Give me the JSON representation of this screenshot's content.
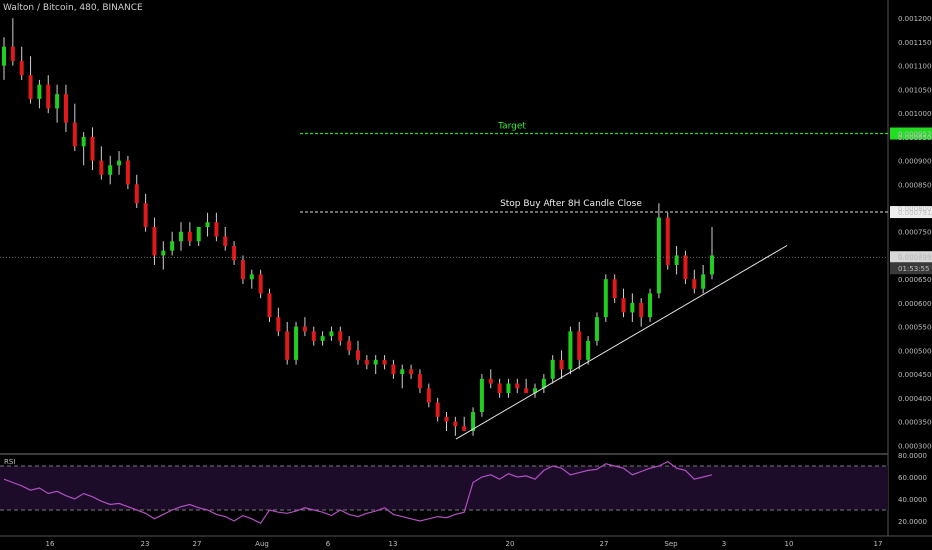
{
  "header": {
    "title": "Walton / Bitcoin, 480, BINANCE"
  },
  "chart_data": [
    {
      "type": "candlestick",
      "ylim": [
        0.00029,
        0.00123
      ],
      "y_ticks": [
        "0.0012000",
        "0.0011500",
        "0.0011000",
        "0.0010500",
        "0.0010000",
        "0.0009500",
        "0.0009000",
        "0.0008500",
        "0.0008000",
        "0.0007500",
        "0.0007000",
        "0.0006500",
        "0.0006000",
        "0.0005500",
        "0.0005000",
        "0.0004500",
        "0.0004000",
        "0.0003500",
        "0.0003000"
      ],
      "x_ticks": [
        "16",
        "23",
        "27",
        "Aug",
        "6",
        "13",
        "20",
        "27",
        "Sep",
        "3",
        "10",
        "17"
      ],
      "candles": [
        [
          0.0011,
          0.00116,
          0.00107,
          0.00114
        ],
        [
          0.00114,
          0.0012,
          0.0011,
          0.00111
        ],
        [
          0.00111,
          0.00114,
          0.00107,
          0.00108
        ],
        [
          0.00108,
          0.00112,
          0.00102,
          0.00103
        ],
        [
          0.00103,
          0.00107,
          0.00101,
          0.00106
        ],
        [
          0.00106,
          0.00108,
          0.001,
          0.00101
        ],
        [
          0.00101,
          0.00106,
          0.00098,
          0.00104
        ],
        [
          0.00104,
          0.00106,
          0.00096,
          0.00098
        ],
        [
          0.00098,
          0.00102,
          0.00092,
          0.00093
        ],
        [
          0.00093,
          0.00096,
          0.00089,
          0.00095
        ],
        [
          0.00095,
          0.00097,
          0.00088,
          0.0009
        ],
        [
          0.0009,
          0.00093,
          0.00086,
          0.00087
        ],
        [
          0.00087,
          0.00091,
          0.00085,
          0.00089
        ],
        [
          0.00089,
          0.00092,
          0.00087,
          0.0009
        ],
        [
          0.0009,
          0.00091,
          0.00084,
          0.00085
        ],
        [
          0.00085,
          0.00087,
          0.0008,
          0.00081
        ],
        [
          0.00081,
          0.00083,
          0.00075,
          0.00076
        ],
        [
          0.00076,
          0.00078,
          0.00068,
          0.0007
        ],
        [
          0.0007,
          0.00073,
          0.00067,
          0.00071
        ],
        [
          0.00071,
          0.00075,
          0.0007,
          0.00073
        ],
        [
          0.00073,
          0.00077,
          0.00071,
          0.00075
        ],
        [
          0.00075,
          0.00077,
          0.00072,
          0.00073
        ],
        [
          0.00073,
          0.00076,
          0.00072,
          0.00076
        ],
        [
          0.00076,
          0.00079,
          0.00074,
          0.00077
        ],
        [
          0.00077,
          0.00079,
          0.00073,
          0.00074
        ],
        [
          0.00074,
          0.00076,
          0.00071,
          0.00072
        ],
        [
          0.00072,
          0.00073,
          0.00068,
          0.00069
        ],
        [
          0.00069,
          0.0007,
          0.00064,
          0.00065
        ],
        [
          0.00065,
          0.00067,
          0.00063,
          0.00066
        ],
        [
          0.00066,
          0.00067,
          0.00061,
          0.00062
        ],
        [
          0.00062,
          0.00063,
          0.00056,
          0.00057
        ],
        [
          0.00057,
          0.00059,
          0.00053,
          0.00054
        ],
        [
          0.00054,
          0.00056,
          0.00047,
          0.00048
        ],
        [
          0.00048,
          0.00056,
          0.00047,
          0.00055
        ],
        [
          0.00055,
          0.00057,
          0.00053,
          0.00054
        ],
        [
          0.00054,
          0.00055,
          0.00051,
          0.00052
        ],
        [
          0.00052,
          0.00054,
          0.00051,
          0.00053
        ],
        [
          0.00053,
          0.00055,
          0.00052,
          0.00054
        ],
        [
          0.00054,
          0.00055,
          0.00051,
          0.00052
        ],
        [
          0.00052,
          0.00053,
          0.00049,
          0.0005
        ],
        [
          0.0005,
          0.00052,
          0.00047,
          0.00048
        ],
        [
          0.00048,
          0.00049,
          0.00046,
          0.00047
        ],
        [
          0.00047,
          0.00049,
          0.00045,
          0.00048
        ],
        [
          0.00048,
          0.00049,
          0.00046,
          0.00047
        ],
        [
          0.00047,
          0.00048,
          0.00044,
          0.00045
        ],
        [
          0.00045,
          0.00047,
          0.00042,
          0.00046
        ],
        [
          0.00046,
          0.00047,
          0.00044,
          0.00045
        ],
        [
          0.00045,
          0.00046,
          0.00041,
          0.00042
        ],
        [
          0.00042,
          0.00043,
          0.00038,
          0.00039
        ],
        [
          0.00039,
          0.0004,
          0.00035,
          0.00036
        ],
        [
          0.00036,
          0.00037,
          0.00033,
          0.00035
        ],
        [
          0.00035,
          0.00036,
          0.00032,
          0.00034
        ],
        [
          0.00034,
          0.00036,
          0.00033,
          0.00033
        ],
        [
          0.00033,
          0.00038,
          0.00032,
          0.00037
        ],
        [
          0.00037,
          0.00045,
          0.00036,
          0.00044
        ],
        [
          0.00044,
          0.00046,
          0.00042,
          0.00043
        ],
        [
          0.00043,
          0.00044,
          0.0004,
          0.00041
        ],
        [
          0.00041,
          0.00044,
          0.0004,
          0.00043
        ],
        [
          0.00043,
          0.00044,
          0.00041,
          0.00042
        ],
        [
          0.00042,
          0.00044,
          0.00041,
          0.00041
        ],
        [
          0.00041,
          0.00043,
          0.0004,
          0.00042
        ],
        [
          0.00042,
          0.00045,
          0.00041,
          0.00044
        ],
        [
          0.00044,
          0.00049,
          0.00043,
          0.00048
        ],
        [
          0.00048,
          0.0005,
          0.00044,
          0.00046
        ],
        [
          0.00046,
          0.00055,
          0.00045,
          0.00054
        ],
        [
          0.00054,
          0.00056,
          0.00046,
          0.00048
        ],
        [
          0.00048,
          0.00053,
          0.00047,
          0.00052
        ],
        [
          0.00052,
          0.00058,
          0.00051,
          0.00057
        ],
        [
          0.00057,
          0.00066,
          0.00056,
          0.00065
        ],
        [
          0.00065,
          0.00066,
          0.0006,
          0.00061
        ],
        [
          0.00061,
          0.00063,
          0.00057,
          0.00058
        ],
        [
          0.00058,
          0.00062,
          0.00056,
          0.0006
        ],
        [
          0.0006,
          0.00061,
          0.00055,
          0.00057
        ],
        [
          0.00057,
          0.00063,
          0.00056,
          0.00062
        ],
        [
          0.00062,
          0.00081,
          0.00061,
          0.00078
        ],
        [
          0.00078,
          0.00079,
          0.00067,
          0.00068
        ],
        [
          0.00068,
          0.00072,
          0.00066,
          0.0007
        ],
        [
          0.0007,
          0.00071,
          0.00064,
          0.00065
        ],
        [
          0.00065,
          0.00067,
          0.00062,
          0.00063
        ],
        [
          0.00063,
          0.00068,
          0.00062,
          0.00066
        ],
        [
          0.00066,
          0.00076,
          0.00065,
          0.0007
        ]
      ],
      "annotations": {
        "target_label": "Target",
        "target_price": "0.0009570",
        "stop_label": "Stop Buy After 8H Candle Close",
        "stop_price": "0.0007915",
        "last_price": "0.0006963",
        "countdown": "01:53:55"
      }
    },
    {
      "type": "line",
      "title": "RSI",
      "ylim": [
        10,
        80
      ],
      "y_ticks": [
        "80.0000",
        "60.0000",
        "40.0000",
        "20.0000"
      ],
      "bands": [
        70,
        30
      ],
      "values": [
        58,
        55,
        52,
        48,
        50,
        45,
        47,
        43,
        40,
        45,
        42,
        38,
        35,
        36,
        33,
        30,
        27,
        22,
        26,
        30,
        33,
        35,
        32,
        30,
        26,
        24,
        20,
        25,
        22,
        18,
        30,
        28,
        27,
        29,
        32,
        30,
        28,
        25,
        30,
        26,
        24,
        27,
        29,
        32,
        26,
        24,
        22,
        20,
        22,
        24,
        23,
        26,
        28,
        55,
        60,
        62,
        58,
        63,
        60,
        61,
        58,
        66,
        70,
        68,
        62,
        64,
        66,
        67,
        72,
        70,
        68,
        62,
        65,
        68,
        70,
        74,
        68,
        66,
        58,
        60,
        62
      ]
    }
  ]
}
